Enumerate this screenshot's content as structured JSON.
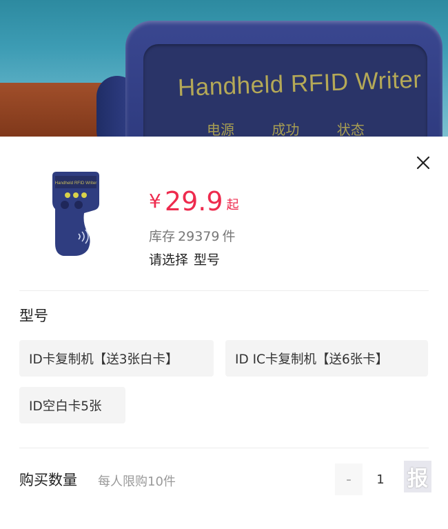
{
  "hero": {
    "device_title": "Handheld RFID Writer",
    "device_labels": [
      "电源",
      "成功",
      "状态"
    ]
  },
  "product": {
    "price_symbol": "¥",
    "price_value": "29.9",
    "price_suffix": "起",
    "stock_label": "库存",
    "stock_count": "29379",
    "stock_unit": "件",
    "select_prefix": "请选择",
    "select_field": "型号",
    "thumb_title": "Handheld RFID Writer"
  },
  "spec": {
    "title": "型号",
    "options": [
      "ID卡复制机【送3张白卡】",
      "ID  IC卡复制机【送6张卡】",
      "ID空白卡5张"
    ]
  },
  "quantity": {
    "label": "购买数量",
    "limit": "每人限购10件",
    "minus": "-",
    "value": "1",
    "plus": "+",
    "watermark": "报"
  },
  "colors": {
    "price": "#ee2b4e",
    "option_bg": "#f4f4f4",
    "device_blue": "#2b377a"
  }
}
